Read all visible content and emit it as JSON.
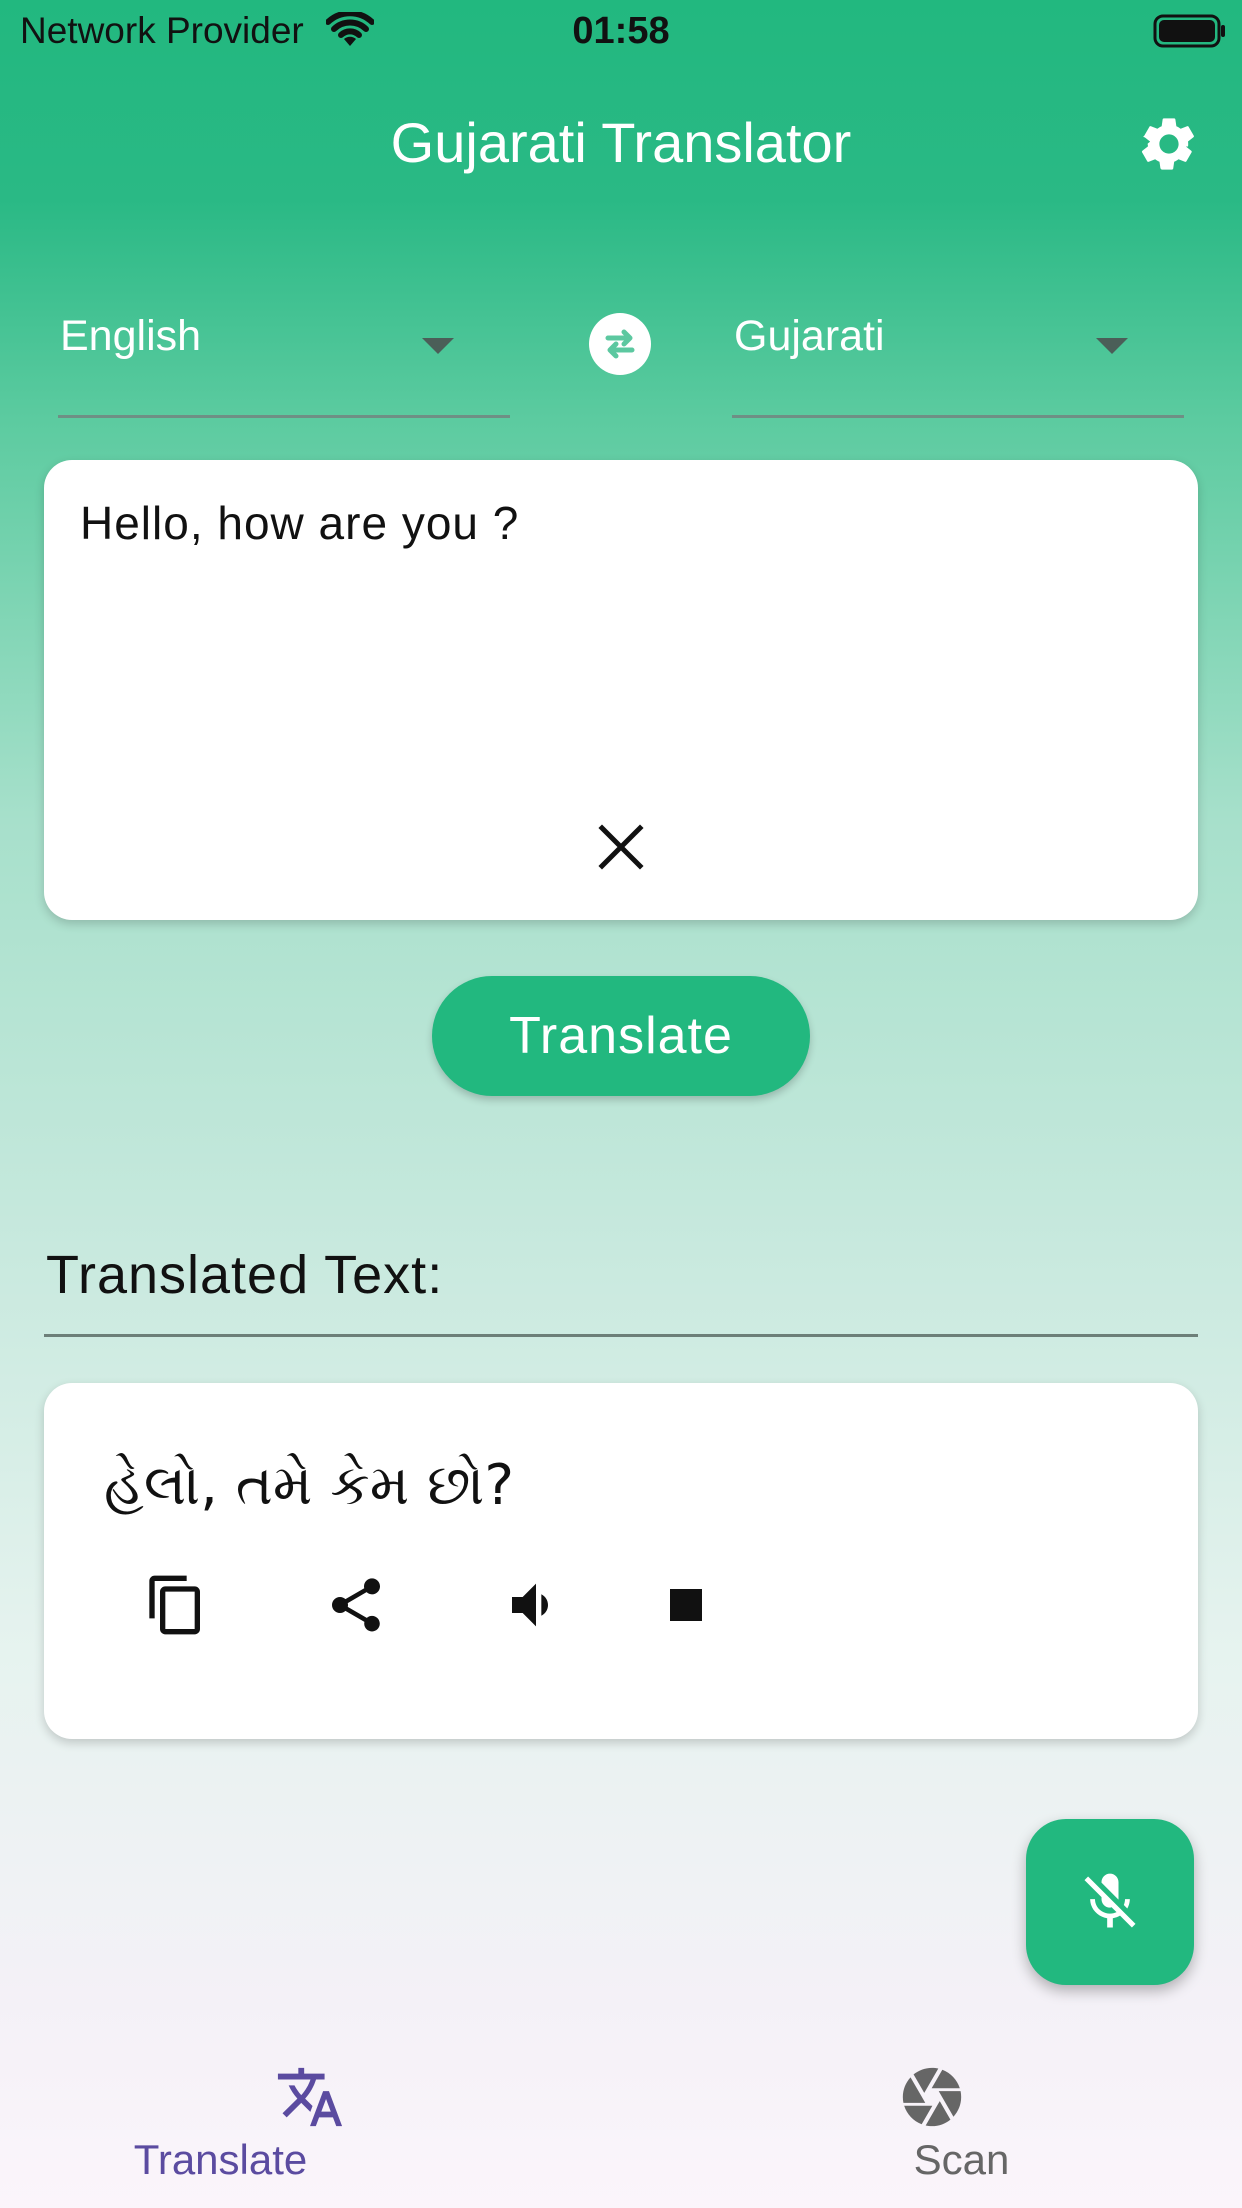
{
  "status_bar": {
    "carrier": "Network Provider",
    "time": "01:58"
  },
  "header": {
    "title": "Gujarati Translator",
    "settings_icon": "gear-icon"
  },
  "languages": {
    "source": "English",
    "target": "Gujarati",
    "swap_icon": "swap-icon"
  },
  "input": {
    "text": "Hello, how are you ?",
    "clear_icon": "close-icon"
  },
  "translate_button": {
    "label": "Translate"
  },
  "output": {
    "heading": "Translated Text:",
    "text": "હેલો, તમે કેમ છો?",
    "actions": [
      "copy-icon",
      "share-icon",
      "volume-icon",
      "stop-icon"
    ]
  },
  "fab": {
    "icon": "mic-off-icon"
  },
  "bottom_nav": {
    "items": [
      {
        "label": "Translate",
        "icon": "translate-icon",
        "active": true
      },
      {
        "label": "Scan",
        "icon": "camera-shutter-icon",
        "active": false
      }
    ]
  },
  "colors": {
    "primary": "#22b87f",
    "nav_active": "#5b4ba0",
    "nav_inactive": "#666666"
  }
}
